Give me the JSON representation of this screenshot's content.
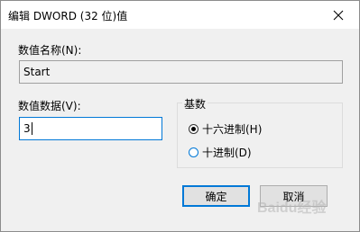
{
  "window": {
    "title": "编辑 DWORD (32 位)值",
    "close_glyph": "✕"
  },
  "value_name": {
    "label": "数值名称(N):",
    "value": "Start"
  },
  "value_data": {
    "label": "数值数据(V):",
    "value": "3"
  },
  "base": {
    "label": "基数",
    "options": [
      {
        "label": "十六进制(H)",
        "selected": true
      },
      {
        "label": "十进制(D)",
        "selected": false
      }
    ]
  },
  "buttons": {
    "ok_label": "确定",
    "cancel_label": "取消"
  },
  "watermark": "Baidu经验",
  "colors": {
    "accent": "#0078d7",
    "dialog_bg": "#f0f0f0",
    "titlebar_bg": "#ffffff"
  }
}
